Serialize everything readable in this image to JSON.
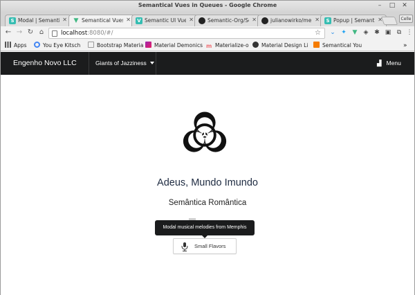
{
  "browser": {
    "window_title": "Semantical Vues in Queues - Google Chrome",
    "profile_label": "Celle",
    "tabs": [
      {
        "label": "Modal | Semantic",
        "favicon": "S",
        "color": "#35bdb2"
      },
      {
        "label": "Semantical Vues",
        "favicon": "V",
        "color": "#41b883",
        "active": true
      },
      {
        "label": "Semantic UI Vue",
        "favicon": "V",
        "color": "#35bdb2"
      },
      {
        "label": "Semantic-Org/Se",
        "favicon": "gh",
        "color": "#222222"
      },
      {
        "label": "julianowirko/me",
        "favicon": "gh",
        "color": "#222222"
      },
      {
        "label": "Popup | Semantic",
        "favicon": "S",
        "color": "#35bdb2"
      }
    ],
    "address": {
      "host": "localhost",
      "rest": ":8080/#/"
    },
    "bookmarks": [
      {
        "label": "Apps",
        "color": "#555555"
      },
      {
        "label": "You Eye Kitsch",
        "color": "#4285f4"
      },
      {
        "label": "Bootstrap Materia",
        "color": "#888888"
      },
      {
        "label": "Material Demonics",
        "color": "#9c27b0"
      },
      {
        "label": "Materialize-o",
        "color": "#ee6e73"
      },
      {
        "label": "Material Design Li",
        "color": "#333333"
      },
      {
        "label": "Semantical You",
        "color": "#f57c00"
      }
    ],
    "bookmarks_overflow": "»"
  },
  "navbar": {
    "brand": "Engenho Novo LLC",
    "dropdown_label": "Giants of Jazziness",
    "menu_label": "Menu"
  },
  "main": {
    "icon": "biohazard-icon",
    "title": "Adeus, Mundo Imundo",
    "subtitle": "Semântica Romântica",
    "tooltip": "Modal musical melodies from Memphis",
    "button_label": "Small Flavors",
    "button_icon": "microphone-icon"
  }
}
